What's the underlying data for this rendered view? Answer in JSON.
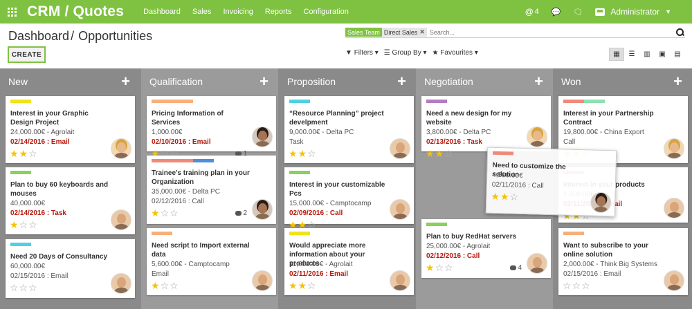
{
  "app": {
    "brand": "CRM / Quotes",
    "menu": [
      "Dashboard",
      "Sales",
      "Invoicing",
      "Reports",
      "Configuration"
    ],
    "mentions_count": "4",
    "user_name": "Administrator"
  },
  "control": {
    "breadcrumb_parent": "Dashboard",
    "breadcrumb_sep": "/",
    "breadcrumb_current": "Opportunities",
    "create_label": "CREATE",
    "search_facet_category": "Sales Team",
    "search_facet_value": "Direct Sales",
    "search_placeholder": "Search...",
    "filters_label": "Filters",
    "groupby_label": "Group By",
    "favourites_label": "Favourites"
  },
  "columns": [
    {
      "title": "New",
      "cards": [
        {
          "tags": [
            "#f2e21c"
          ],
          "title": "Interest in your Graphic Design Project",
          "revenue": "24,000.00€ - Agrolait",
          "date": "02/14/2016 : Email",
          "date_overdue": true,
          "stars": 2,
          "avatar": "blond"
        },
        {
          "tags": [
            "#8ccf5b"
          ],
          "title": "Plan to buy 60 keyboards and mouses",
          "revenue": "40,000.00€",
          "date": "02/14/2016 : Task",
          "date_overdue": true,
          "stars": 1,
          "avatar": "man"
        },
        {
          "tags": [
            "#4fd0e3"
          ],
          "title": "Need 20 Days of Consultancy",
          "revenue": "60,000.00€",
          "date": "02/15/2016 : Email",
          "date_overdue": false,
          "stars": 0,
          "avatar": "man"
        }
      ]
    },
    {
      "title": "Qualification",
      "cards": [
        {
          "tags": [
            "#f7b07a",
            "#f7b07a"
          ],
          "title": "Pricing Information of Services",
          "revenue": "1,000.00€",
          "date": "02/10/2016 : Email",
          "date_overdue": true,
          "stars": 1,
          "messages": "1",
          "avatar": "dark"
        },
        {
          "tags": [
            "#f08a78",
            "#f08a78",
            "#4e8fd9"
          ],
          "title": "Trainee's training plan in your Organization",
          "revenue": "35,000.00€ - Delta PC",
          "date": "02/12/2016 : Call",
          "date_overdue": false,
          "stars": 1,
          "messages": "2",
          "avatar": "dark"
        },
        {
          "tags": [
            "#f7b07a"
          ],
          "title": "Need script to Import external data",
          "revenue": "5,600.00€ - Camptocamp",
          "plain": "Email",
          "stars": 1,
          "avatar": "man"
        }
      ]
    },
    {
      "title": "Proposition",
      "cards": [
        {
          "tags": [
            "#4fd0e3"
          ],
          "title": "“Resource Planning” project develpment",
          "revenue": "9,000.00€ - Delta PC",
          "plain": "Task",
          "stars": 2,
          "avatar": "man"
        },
        {
          "tags": [
            "#8ccf5b"
          ],
          "title": "Interest in your customizable Pcs",
          "revenue": "15,000.00€ - Camptocamp",
          "date": "02/09/2016 : Call",
          "date_overdue": true,
          "stars": 2,
          "avatar": "man"
        },
        {
          "tags": [
            "#f2e21c"
          ],
          "title": "Would appreciate more information about your products",
          "revenue": "11,000.00€ - Agrolait",
          "date": "02/11/2016 : Email",
          "date_overdue": true,
          "stars": 2,
          "avatar": "man"
        }
      ]
    },
    {
      "title": "Negotiation",
      "cards": [
        {
          "tags": [
            "#b27cc4"
          ],
          "title": "Need a new design for my website",
          "revenue": "3,800.00€ - Delta PC",
          "date": "02/13/2016 : Task",
          "date_overdue": true,
          "stars": 2,
          "avatar": "blond"
        },
        {
          "tags": [
            "#8ccf5b"
          ],
          "title": "Plan to buy RedHat servers",
          "revenue": "25,000.00€ - Agrolait",
          "date": "02/12/2016 : Call",
          "date_overdue": true,
          "stars": 1,
          "messages": "4",
          "avatar": "man"
        }
      ]
    },
    {
      "title": "Won",
      "cards": [
        {
          "tags": [
            "#f08a78",
            "#8ee0b0"
          ],
          "title": "Interest in your Partnership Contract",
          "revenue": "19,800.00€ - China Export",
          "plain": "Call",
          "stars": 2,
          "avatar": "blond"
        },
        {
          "tags": [
            "#f08a78"
          ],
          "title": "Interest in your products",
          "revenue": "1,000.00€",
          "date": "02/11/2016 : Email",
          "date_overdue": true,
          "stars": 2,
          "avatar": "man"
        },
        {
          "tags": [
            "#f7b07a"
          ],
          "title": "Want to subscribe to your online solution",
          "revenue": "2,000.00€ - Think Big Systems",
          "date": "02/15/2016 : Email",
          "date_overdue": false,
          "stars": 0,
          "avatar": "man"
        }
      ]
    }
  ],
  "dragging_card": {
    "tags": [
      "#f08a78"
    ],
    "title": "Need to customize the solution",
    "revenue": "4,500.00€",
    "date": "02/11/2016 : Call",
    "stars": 2,
    "avatar": "dark"
  }
}
